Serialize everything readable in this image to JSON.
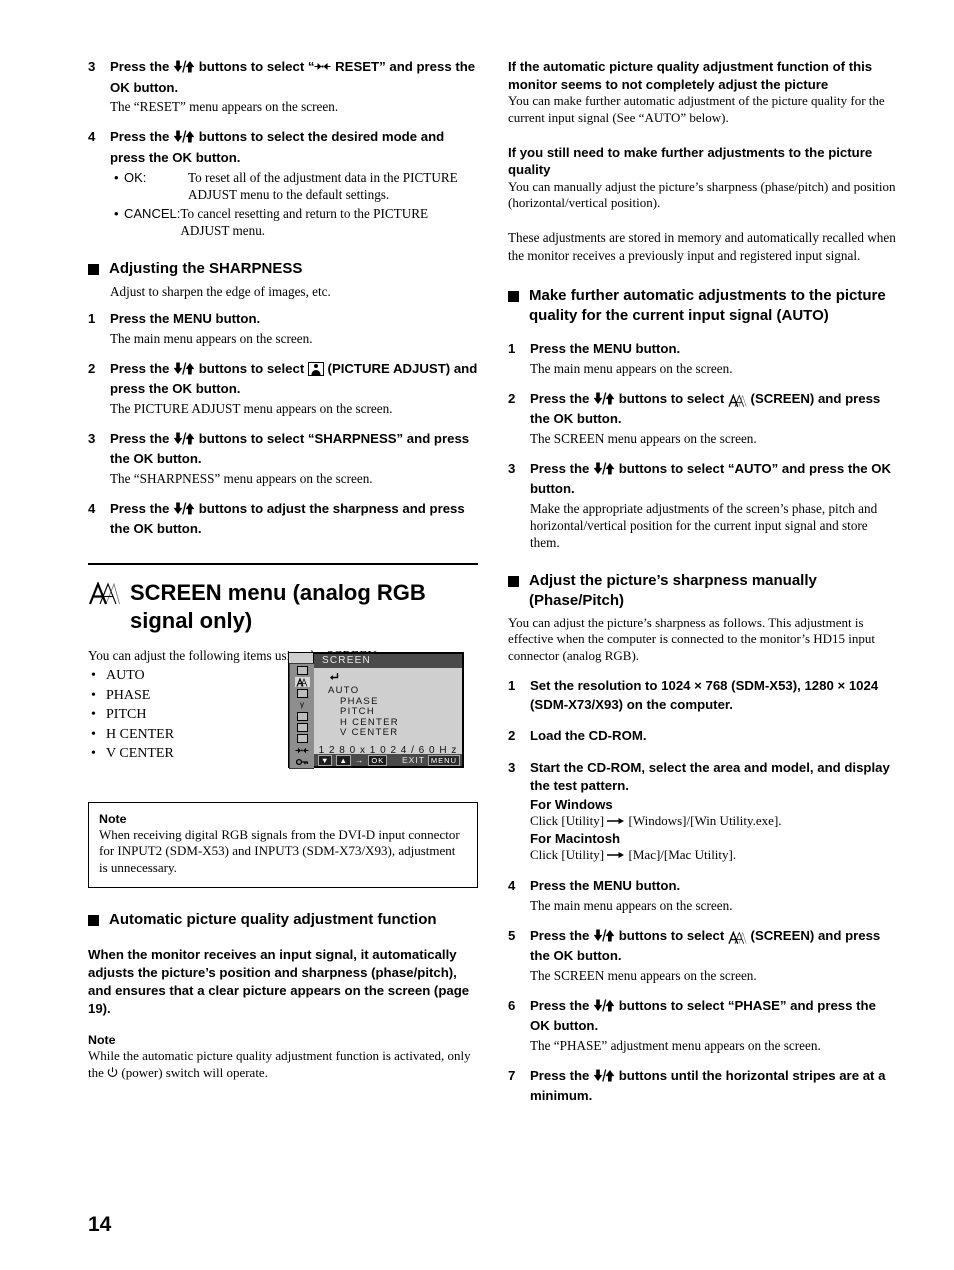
{
  "page": {
    "number": "14"
  },
  "left_column": {
    "steps_reset": [
      {
        "num": "3",
        "title_pre": "Press the ",
        "title_mid": " buttons to select “",
        "title_post": " RESET” and press the OK button.",
        "desc": "The “RESET” menu appears on the screen."
      },
      {
        "num": "4",
        "title_pre": "Press the ",
        "title_post": " buttons to select the desired mode and press the OK button.",
        "bullets": [
          {
            "term": "OK:",
            "def": "To reset all of the adjustment data in the PICTURE ADJUST menu to the default settings."
          },
          {
            "term": "CANCEL:",
            "def": "To cancel resetting and return to the PICTURE ADJUST menu."
          }
        ]
      }
    ],
    "sharpness_heading": "Adjusting the SHARPNESS",
    "sharpness_intro": "Adjust to sharpen the edge of images, etc.",
    "steps_sharpness": [
      {
        "num": "1",
        "title": "Press the MENU button.",
        "desc": "The main menu appears on the screen."
      },
      {
        "num": "2",
        "title_pre": "Press the ",
        "title_mid": " buttons to select ",
        "title_post": " (PICTURE ADJUST) and press the OK button.",
        "desc": "The PICTURE ADJUST menu appears on the screen."
      },
      {
        "num": "3",
        "title_pre": "Press the ",
        "title_post": " buttons to select “SHARPNESS” and press the OK button.",
        "desc": "The “SHARPNESS” menu appears on the screen."
      },
      {
        "num": "4",
        "title_pre": "Press the ",
        "title_post": " buttons to adjust the sharpness and press the OK button.",
        "desc": ""
      }
    ],
    "screen_menu_heading": "SCREEN menu (analog RGB signal only)",
    "screen_menu_intro": "You can adjust the following items using the SCREEN menu.",
    "screen_menu_items": [
      "AUTO",
      "PHASE",
      "PITCH",
      "H CENTER",
      "V CENTER"
    ],
    "osd": {
      "title": "SCREEN",
      "back_glyph": "↰",
      "items": [
        "AUTO",
        "PHASE",
        "PITCH",
        "H  CENTER",
        "V  CENTER"
      ],
      "resolution": "1 2 8 0 x 1 0 2 4 / 6 0 H z",
      "bar_ok": "OK",
      "bar_exit": "EXIT",
      "bar_menu": "MENU",
      "sidebar_icons": [
        "picture-adjust-icon",
        "screen-icon",
        "color-icon",
        "gamma-icon",
        "menu-position-icon",
        "input-sensing-icon",
        "language-icon",
        "reset-icon",
        "menu-lock-icon"
      ]
    },
    "note_box": {
      "title": "Note",
      "text": "When receiving digital RGB signals from the DVI-D input connector for INPUT2 (SDM-X53) and INPUT3 (SDM-X73/X93), adjustment is unnecessary."
    },
    "auto_quality_heading": "Automatic picture quality adjustment function",
    "auto_quality_bold": "When the monitor receives an input signal, it automatically adjusts the picture’s position and sharpness (phase/pitch), and ensures that a clear picture appears on the screen (page 19).",
    "note2": {
      "title": "Note",
      "text_pre": "While the automatic picture quality adjustment function is activated, only the ",
      "text_post": " (power) switch will operate."
    }
  },
  "right_column": {
    "intro_blocks": [
      {
        "heading": "If the automatic picture quality adjustment function of this monitor seems to not completely adjust the picture",
        "body": "You can make further automatic adjustment of the picture quality for the current input signal (See “AUTO” below)."
      },
      {
        "heading": "If you still need to make further adjustments to the picture quality",
        "body": "You can manually adjust the picture’s sharpness (phase/pitch) and position (horizontal/vertical position)."
      }
    ],
    "stored_para": "These adjustments are stored in memory and automatically recalled when the monitor receives a previously input and registered input signal.",
    "auto_heading": "Make further automatic adjustments to the picture quality for the current input signal (AUTO)",
    "steps_auto": [
      {
        "num": "1",
        "title": "Press the MENU button.",
        "desc": "The main menu appears on the screen."
      },
      {
        "num": "2",
        "title_pre": "Press the ",
        "title_mid": " buttons to select ",
        "title_post": " (SCREEN) and press the OK button.",
        "desc": "The SCREEN menu appears on the screen."
      },
      {
        "num": "3",
        "title_pre": "Press the ",
        "title_post": " buttons to select “AUTO” and press the OK button.",
        "desc": "Make the appropriate adjustments of the screen’s phase, pitch and horizontal/vertical position for the current input signal and store them."
      }
    ],
    "manual_heading": "Adjust the picture’s sharpness manually (Phase/Pitch)",
    "manual_intro": "You can adjust the picture’s sharpness as follows. This adjustment is effective when the computer is connected to the monitor’s HD15 input connector (analog RGB).",
    "steps_manual": [
      {
        "num": "1",
        "title": "Set the resolution to 1024 × 768 (SDM-X53), 1280 × 1024 (SDM-X73/X93) on the computer.",
        "desc": ""
      },
      {
        "num": "2",
        "title": "Load the CD-ROM.",
        "desc": ""
      },
      {
        "num": "3",
        "title": "Start the CD-ROM, select the area and model, and display the test pattern.",
        "sub_windows_label": "For Windows",
        "sub_windows_text_pre": "Click [Utility] ",
        "sub_windows_text_post": " [Windows]/[Win Utility.exe].",
        "sub_mac_label": "For Macintosh",
        "sub_mac_text_pre": "Click [Utility] ",
        "sub_mac_text_post": " [Mac]/[Mac Utility]."
      },
      {
        "num": "4",
        "title": "Press the MENU button.",
        "desc": "The main menu appears on the screen."
      },
      {
        "num": "5",
        "title_pre": "Press the ",
        "title_mid": " buttons to select ",
        "title_post": " (SCREEN) and press the OK button.",
        "desc": "The SCREEN menu appears on the screen."
      },
      {
        "num": "6",
        "title_pre": "Press the ",
        "title_post": " buttons to select “PHASE” and press the OK button.",
        "desc": "The “PHASE” adjustment menu appears on the screen."
      },
      {
        "num": "7",
        "title_pre": "Press the ",
        "title_post": " buttons until the horizontal stripes are at a minimum.",
        "desc": ""
      }
    ]
  }
}
